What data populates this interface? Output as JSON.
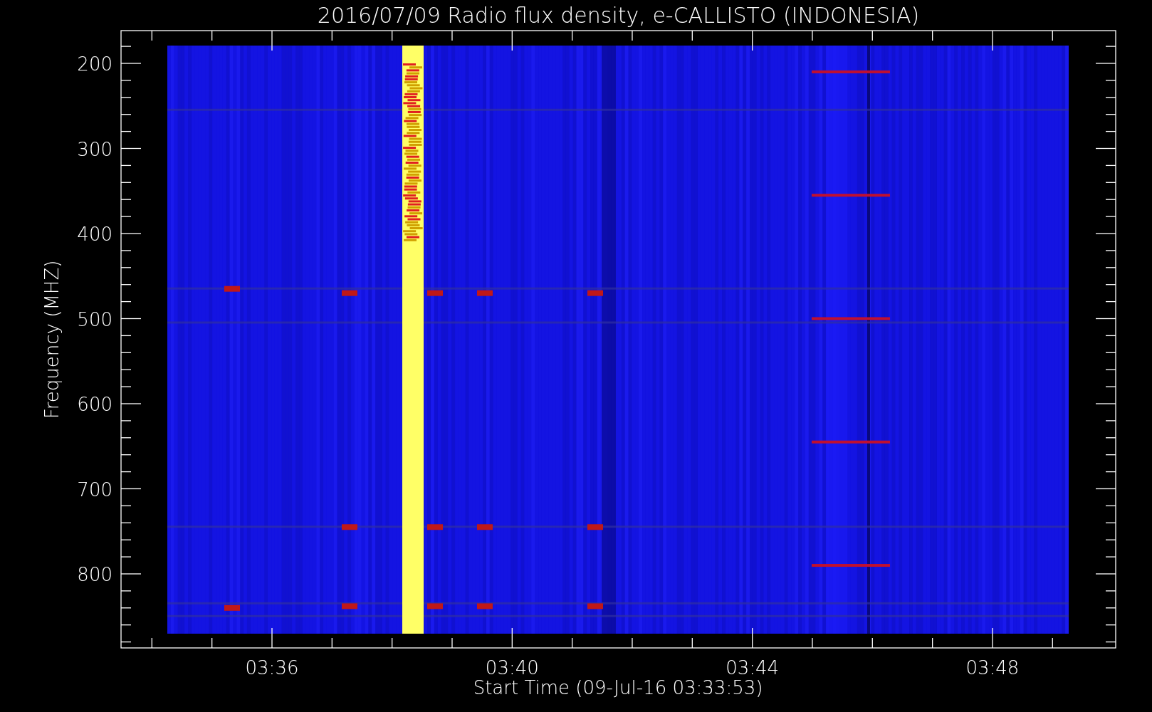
{
  "title": "2016/07/09  Radio flux density, e-CALLISTO (INDONESIA)",
  "y_axis": {
    "label": "Frequency (MHZ)",
    "ticks": [
      "200",
      "300",
      "400",
      "500",
      "600",
      "700",
      "800"
    ]
  },
  "x_axis": {
    "label": "Start Time (09-Jul-16 03:33:53)",
    "ticks": [
      "03:36",
      "03:40",
      "03:44",
      "03:48"
    ]
  }
}
